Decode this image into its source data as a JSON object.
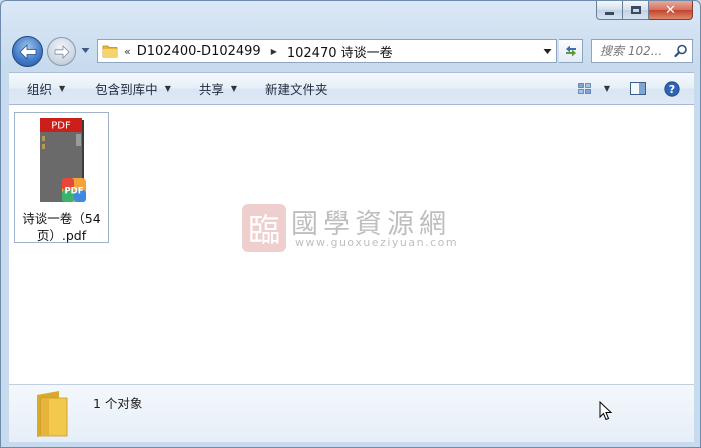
{
  "window": {
    "caption": {
      "minimize_glyph": "▁",
      "maximize_glyph": "□",
      "close_glyph": "✕"
    }
  },
  "nav": {
    "back_icon": "back-arrow-icon",
    "forward_icon": "forward-arrow-icon",
    "history_icon": "chevron-down-icon"
  },
  "address": {
    "overflow": "«",
    "crumbs": [
      "D102400-D102499",
      "102470 诗谈一卷"
    ],
    "separator": "▶"
  },
  "search": {
    "placeholder": "搜索 102..."
  },
  "toolbar": {
    "organize": "组织",
    "include_library": "包含到库中",
    "share": "共享",
    "new_folder": "新建文件夹"
  },
  "files": [
    {
      "name": "诗谈一卷（54页）.pdf",
      "type": "pdf",
      "thumb_label": "PDF",
      "badge_label": "PDF"
    }
  ],
  "watermark": {
    "seal": "臨",
    "title": "國學資源網",
    "url": "www.guoxueziyuan.com"
  },
  "details": {
    "status": "1 个对象"
  },
  "colors": {
    "accent": "#3f79c5",
    "pdf_red": "#cc1f1a",
    "folder_yellow": "#f2c94c"
  }
}
